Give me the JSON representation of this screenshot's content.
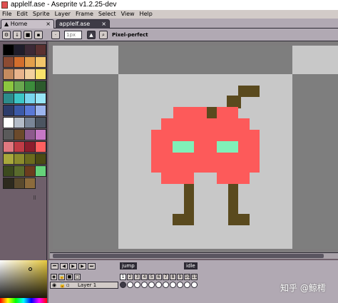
{
  "window": {
    "title": "applelf.ase - Aseprite v1.2.25-dev"
  },
  "menu": [
    "File",
    "Edit",
    "Sprite",
    "Layer",
    "Frame",
    "Select",
    "View",
    "Help"
  ],
  "tabs": {
    "home": {
      "label": "Home"
    },
    "file": {
      "label": "applelf.ase"
    }
  },
  "toolbar": {
    "brush_size": "1px",
    "pixel_perfect_label": "Pixel-perfect"
  },
  "palette": [
    [
      "#000000",
      "#1f1d2b",
      "#3c2936",
      "#5a3030"
    ],
    [
      "#8c4b33",
      "#d26e2d",
      "#e39f4b",
      "#f2c56b"
    ],
    [
      "#c58b5f",
      "#e8b48c",
      "#f2d09e",
      "#fae36b"
    ],
    [
      "#8cc63f",
      "#6aa84f",
      "#3c8c3c",
      "#2d5a2d"
    ],
    [
      "#2d8c8c",
      "#3cc6c6",
      "#78d6ee",
      "#98e6f8"
    ],
    [
      "#2d3c6b",
      "#3c5aa8",
      "#5a78d6",
      "#9cb4ee"
    ],
    [
      "#ffffff",
      "#b4bcc8",
      "#7a8698",
      "#4b5460"
    ],
    [
      "#5a5a5a",
      "#6b4a2b",
      "#8c5a8c",
      "#c678c6"
    ],
    [
      "#e07880",
      "#c03c46",
      "#8c1e2d",
      "#ff6060"
    ],
    [
      "#a8a83c",
      "#8c8c2d",
      "#6b6b1e",
      "#4b4b14"
    ],
    [
      "#3c4a1e",
      "#5a6b2d",
      "#6b3c1e",
      "#66d27a"
    ],
    [
      "#2d2a1e",
      "#5a4a2d",
      "#8c6b3c",
      ""
    ]
  ],
  "colors": {
    "apple": "#fd5a5a",
    "eyes": "#80f0b8",
    "stem": "#5a4a1e",
    "checker_light": "#c8c8c8",
    "checker_dark": "#7e7e7e"
  },
  "timeline": {
    "tags": {
      "jump": "jump",
      "idle": "idle"
    },
    "frames": [
      "1",
      "2",
      "3",
      "4",
      "5",
      "6",
      "7",
      "8",
      "9",
      "10",
      "11"
    ],
    "layer_name": "Layer 1"
  },
  "watermark": "知乎 @鲸樗"
}
